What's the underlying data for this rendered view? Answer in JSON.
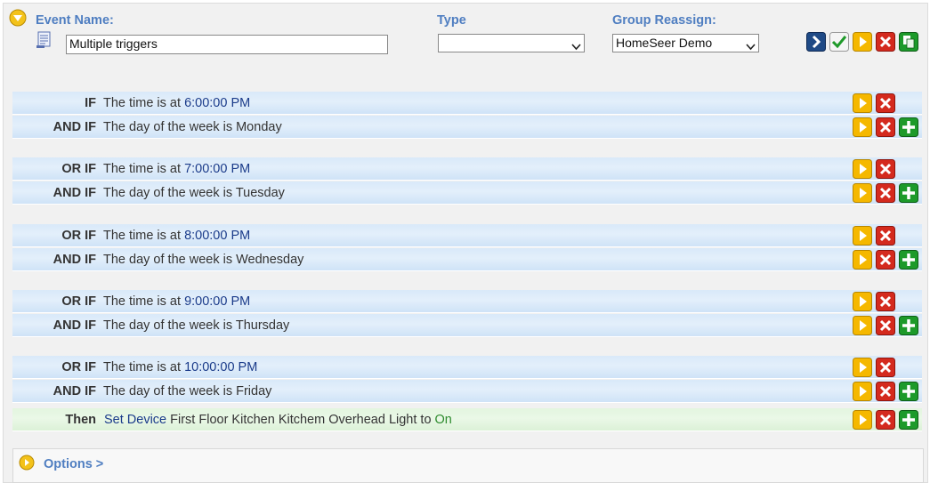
{
  "header": {
    "event_name_label": "Event Name:",
    "event_name_value": "Multiple triggers",
    "type_label": "Type",
    "type_value": "",
    "group_label": "Group Reassign:",
    "group_value": "HomeSeer Demo"
  },
  "rows": [
    {
      "kw": "IF",
      "text": "The time is at ",
      "value": "6:00:00 PM"
    },
    {
      "kw": "AND IF",
      "text": "The day of the week is Monday",
      "value": ""
    },
    {
      "kw": "OR IF",
      "text": "The time is at ",
      "value": "7:00:00 PM"
    },
    {
      "kw": "AND IF",
      "text": "The day of the week is Tuesday",
      "value": ""
    },
    {
      "kw": "OR IF",
      "text": "The time is at ",
      "value": "8:00:00 PM"
    },
    {
      "kw": "AND IF",
      "text": "The day of the week is Wednesday",
      "value": ""
    },
    {
      "kw": "OR IF",
      "text": "The time is at ",
      "value": "9:00:00 PM"
    },
    {
      "kw": "AND IF",
      "text": "The day of the week is Thursday",
      "value": ""
    },
    {
      "kw": "OR IF",
      "text": "The time is at ",
      "value": "10:00:00 PM"
    },
    {
      "kw": "AND IF",
      "text": "The day of the week is Friday",
      "value": ""
    }
  ],
  "then": {
    "kw": "Then",
    "set_device": "Set Device",
    "device": " First Floor Kitchen Kitchem Overhead Light to ",
    "state": "On"
  },
  "options": {
    "label": "Options >"
  },
  "colors": {
    "label_blue": "#4f7ec1",
    "row_blue": "#dce9f8",
    "row_green": "#e5f5e1",
    "btn_yellow": "#f5b800",
    "btn_red": "#d42a1e",
    "btn_green": "#1d9a2a",
    "btn_navy": "#1f4a86"
  },
  "icons": [
    "collapse-arrow-icon",
    "note-icon",
    "go-icon",
    "check-icon",
    "play-icon",
    "delete-icon",
    "add-icon",
    "copy-icon",
    "options-arrow-icon"
  ]
}
